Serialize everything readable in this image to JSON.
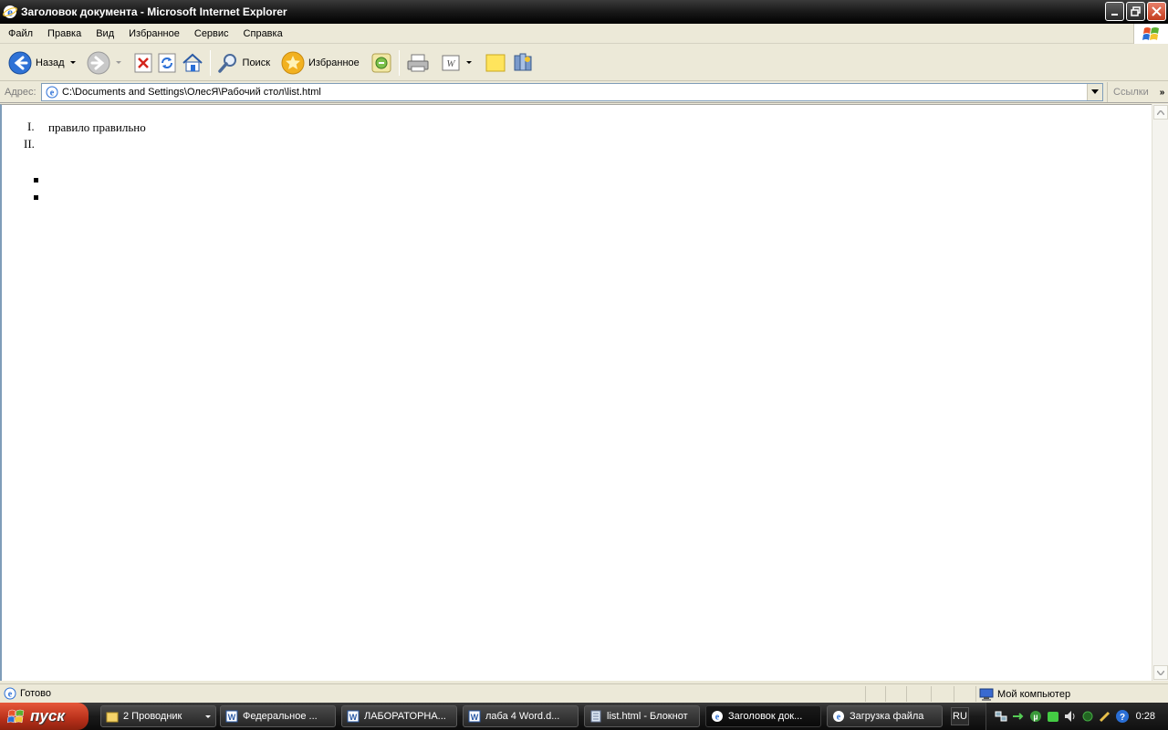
{
  "window": {
    "title": "Заголовок документа - Microsoft Internet Explorer"
  },
  "menu": [
    "Файл",
    "Правка",
    "Вид",
    "Избранное",
    "Сервис",
    "Справка"
  ],
  "toolbar": {
    "back_label": "Назад",
    "search_label": "Поиск",
    "favorites_label": "Избранное"
  },
  "address": {
    "label": "Адрес:",
    "value": "C:\\Documents and Settings\\ОлесЯ\\Рабочий стол\\list.html",
    "links_label": "Ссылки"
  },
  "content": {
    "ordered": [
      {
        "marker": "I.",
        "text": "правило правильно"
      },
      {
        "marker": "II.",
        "text": ""
      }
    ],
    "bullets_count": 2
  },
  "status": {
    "text": "Готово",
    "zone": "Мой компьютер"
  },
  "taskbar": {
    "start_label": "пуск",
    "tasks": [
      {
        "label": "2 Проводник",
        "icon": "folder-icon"
      },
      {
        "label": "Федеральное ...",
        "icon": "word-icon"
      },
      {
        "label": "ЛАБОРАТОРНА...",
        "icon": "word-icon"
      },
      {
        "label": "лаба 4 Word.d...",
        "icon": "word-icon"
      },
      {
        "label": "list.html - Блокнот",
        "icon": "notepad-icon"
      },
      {
        "label": "Заголовок док...",
        "icon": "ie-icon"
      },
      {
        "label": "Загрузка файла",
        "icon": "ie-icon"
      }
    ],
    "language": "RU",
    "clock": "0:28"
  },
  "colors": {
    "accent": "#316ac5",
    "start_button": "#c8391f",
    "close_button": "#d64f33"
  }
}
